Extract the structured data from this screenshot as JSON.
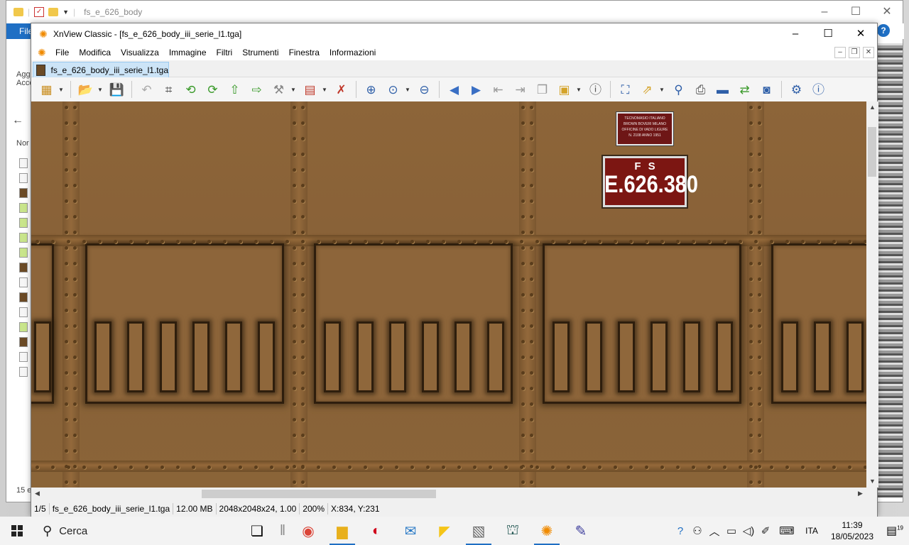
{
  "explorer": {
    "title": "fs_e_626_body",
    "file_tab": "File",
    "side_texts": [
      "Agg",
      "Acce",
      "Nor"
    ],
    "item_count": "15 e"
  },
  "xnview": {
    "window_title": "XnView Classic - [fs_e_626_body_iii_serie_l1.tga]",
    "menu": [
      "File",
      "Modifica",
      "Visualizza",
      "Immagine",
      "Filtri",
      "Strumenti",
      "Finestra",
      "Informazioni"
    ],
    "tab_label": "fs_e_626_body_iii_serie_l1.tga",
    "toolbar_icons": [
      "browser-icon",
      "open-icon",
      "save-icon",
      "undo-icon",
      "crop-icon",
      "rotate-left-icon",
      "rotate-right-icon",
      "up-icon",
      "move-icon",
      "tools-icon",
      "palette-icon",
      "effects-icon",
      "zoom-in-icon",
      "zoom-fit-icon",
      "zoom-out-icon",
      "prev-icon",
      "next-icon",
      "first-icon",
      "last-icon",
      "copy-icon",
      "slideshow-icon",
      "info-icon",
      "fullscreen-icon",
      "export-icon",
      "search-icon",
      "print-icon",
      "scan-icon",
      "convert-icon",
      "capture-icon",
      "settings-icon",
      "about-icon"
    ],
    "image": {
      "plate_small_lines": [
        "TECNOMASIO ITALIANO",
        "BROWN BOVERI MILANO",
        "OFFICINE DI VADO LIGURE",
        "N. 2108    ANNO 1951"
      ],
      "plate_big_top": "FS",
      "plate_big_number": "E.626.380"
    },
    "status": {
      "index": "1/5",
      "filename": "fs_e_626_body_iii_serie_l1.tga",
      "size": "12.00 MB",
      "dims": "2048x2048x24, 1.00",
      "zoom": "200%",
      "coords": "X:834, Y:231"
    }
  },
  "taskbar": {
    "search_placeholder": "Cerca",
    "language": "ITA",
    "time": "11:39",
    "date": "18/05/2023",
    "notification_count": "19"
  },
  "colors": {
    "accent": "#1f6fc4",
    "texture_brown": "#8a6438",
    "plate_red": "#7c1612"
  }
}
